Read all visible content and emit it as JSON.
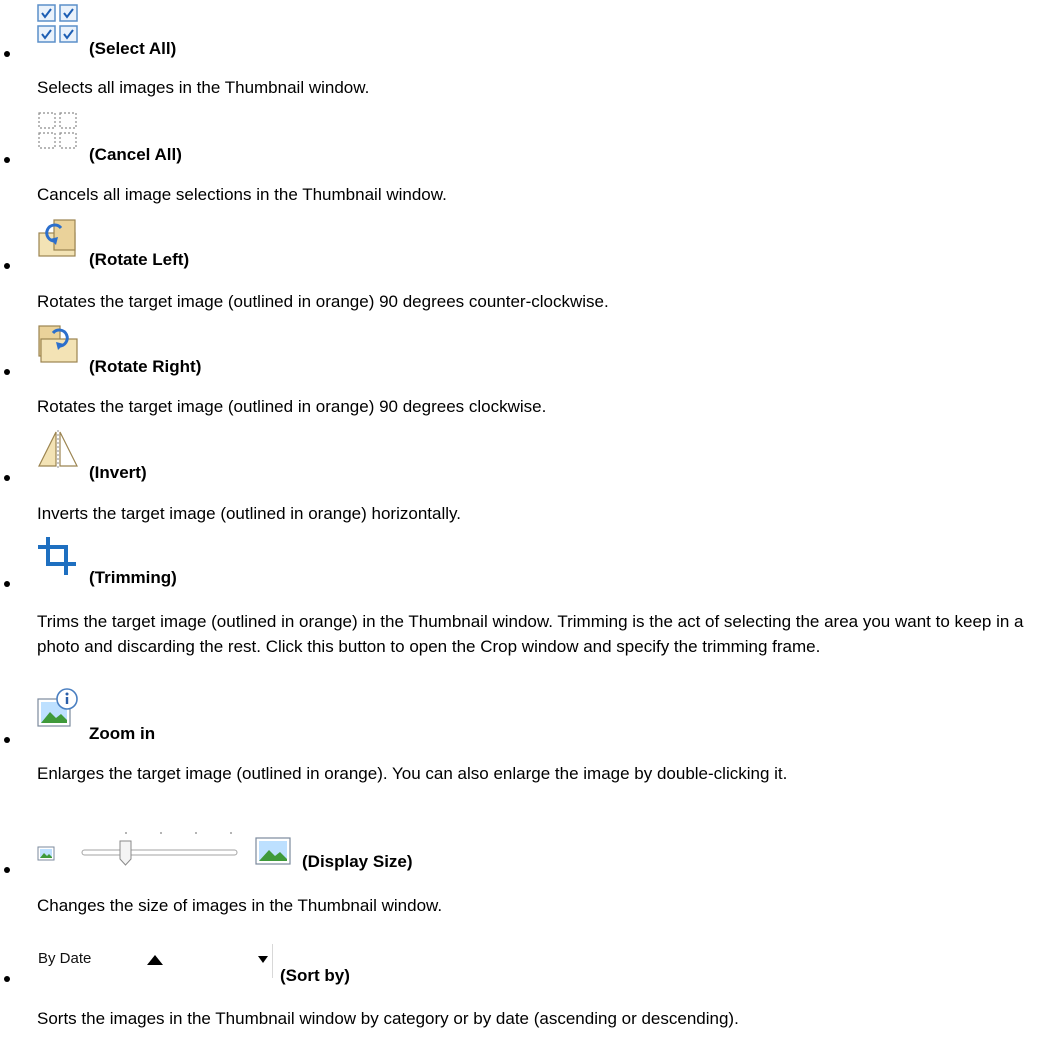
{
  "items": [
    {
      "label": "(Select All)",
      "description": "Selects all images in the Thumbnail window.",
      "icon": "select-all-icon"
    },
    {
      "label": "(Cancel All)",
      "description": "Cancels all image selections in the Thumbnail window.",
      "icon": "cancel-all-icon"
    },
    {
      "label": "(Rotate Left)",
      "description": "Rotates the target image (outlined in orange) 90 degrees counter-clockwise.",
      "icon": "rotate-left-icon"
    },
    {
      "label": "(Rotate Right)",
      "description": "Rotates the target image (outlined in orange) 90 degrees clockwise.",
      "icon": "rotate-right-icon"
    },
    {
      "label": "(Invert)",
      "description": "Inverts the target image (outlined in orange) horizontally.",
      "icon": "invert-icon"
    },
    {
      "label": "(Trimming)",
      "description": "Trims the target image (outlined in orange) in the Thumbnail window. Trimming is the act of selecting the area you want to keep in a photo and discarding the rest. Click this button to open the Crop window and specify the trimming frame.",
      "icon": "trimming-icon"
    },
    {
      "label": "Zoom in",
      "description": "Enlarges the target image (outlined in orange). You can also enlarge the image by double-clicking it.",
      "icon": "zoom-in-icon"
    },
    {
      "label": "(Display Size)",
      "description": "Changes the size of images in the Thumbnail window.",
      "icon": "display-size-slider"
    },
    {
      "label": "(Sort by)",
      "description": "Sorts the images in the Thumbnail window by category or by date (ascending or descending).",
      "icon": "sort-by-dropdown",
      "selected_value": "By Date"
    }
  ]
}
